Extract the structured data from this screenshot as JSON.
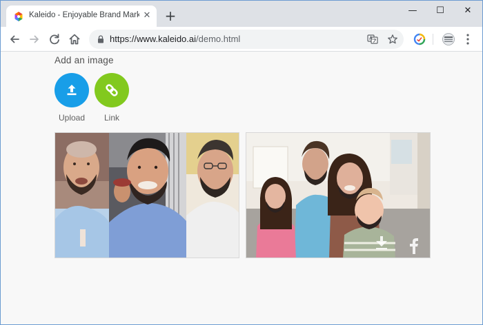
{
  "browser": {
    "tab": {
      "title": "Kaleido - Enjoyable Brand Marke",
      "close_glyph": "✕",
      "favicon": "kaleido-favicon"
    },
    "new_tab_glyph": "+",
    "window_controls": {
      "minimize": "—",
      "maximize": "☐",
      "close": "✕"
    },
    "omnibox": {
      "url_base": "https://www.kaleido.ai",
      "url_path": "/demo.html"
    },
    "icons": [
      "back-icon",
      "forward-icon",
      "reload-icon",
      "home-icon",
      "lock-icon",
      "translate-icon",
      "star-icon",
      "extension-icon",
      "profile-icon",
      "menu-icon"
    ]
  },
  "page": {
    "heading": "Add an image",
    "actions": [
      {
        "label": "Upload",
        "icon": "upload-icon",
        "color": "#189ee8"
      },
      {
        "label": "Link",
        "icon": "link-icon",
        "color": "#82c91e"
      }
    ],
    "photos": [
      {
        "name": "men-group-photo",
        "description_visible": false
      },
      {
        "name": "family-photo",
        "overlay_icons": [
          "download-icon",
          "facebook-icon"
        ]
      }
    ]
  }
}
